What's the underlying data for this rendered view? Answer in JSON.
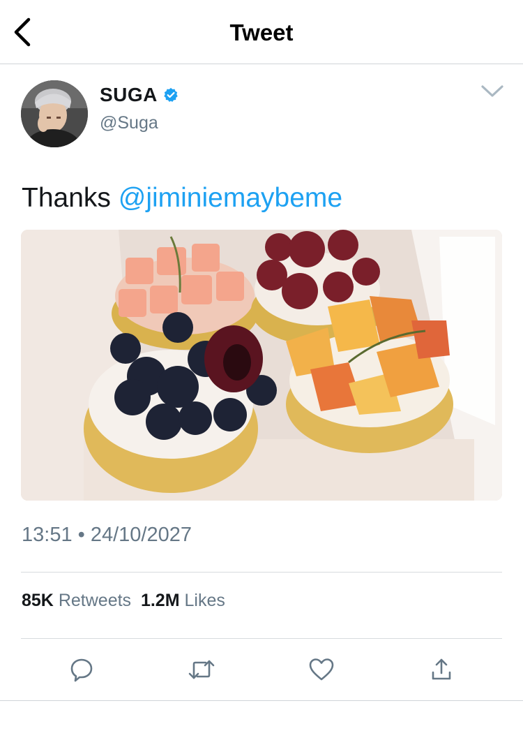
{
  "header": {
    "title": "Tweet",
    "back_icon": "chevron-left-icon"
  },
  "author": {
    "display_name": "SUGA",
    "handle": "@Suga",
    "verified": true,
    "avatar_description": "profile photo"
  },
  "tweet": {
    "text_prefix": "Thanks ",
    "mention": "@jiminiemaybeme",
    "image_alt": "fruit tarts in a box",
    "time": "13:51",
    "separator": "•",
    "date": "24/10/2027"
  },
  "stats": {
    "retweets_count": "85K",
    "retweets_label": "Retweets",
    "likes_count": "1.2M",
    "likes_label": "Likes"
  },
  "actions": [
    "reply-icon",
    "retweet-icon",
    "like-icon",
    "share-icon"
  ],
  "colors": {
    "accent": "#1da1f2",
    "muted": "#657786",
    "text": "#14171a",
    "verified": "#1da1f2"
  }
}
